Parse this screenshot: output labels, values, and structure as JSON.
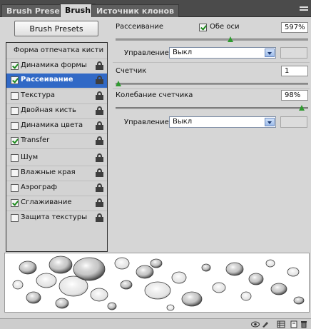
{
  "tabs": [
    {
      "label": "Brush Presets"
    },
    {
      "label": "Brush"
    },
    {
      "label": "Источник клонов"
    }
  ],
  "preset_button": "Brush Presets",
  "list": {
    "header": "Форма отпечатка кисти",
    "items": [
      {
        "label": "Динамика формы",
        "checked": true,
        "selected": false
      },
      {
        "label": "Рассеивание",
        "checked": true,
        "selected": true
      },
      {
        "label": "Текстура",
        "checked": false,
        "selected": false
      },
      {
        "label": "Двойная кисть",
        "checked": false,
        "selected": false
      },
      {
        "label": "Динамика цвета",
        "checked": false,
        "selected": false
      },
      {
        "label": "Transfer",
        "checked": true,
        "selected": false
      },
      {
        "label": "Шум",
        "checked": false,
        "selected": false
      },
      {
        "label": "Влажные края",
        "checked": false,
        "selected": false
      },
      {
        "label": "Аэрограф",
        "checked": false,
        "selected": false
      },
      {
        "label": "Сглаживание",
        "checked": true,
        "selected": false
      },
      {
        "label": "Защита текстуры",
        "checked": false,
        "selected": false
      }
    ]
  },
  "scatter": {
    "label": "Рассеивание",
    "both_axes_label": "Обе оси",
    "both_axes_checked": true,
    "value": "597%",
    "slider_fraction": 0.6,
    "control_label": "Управление:",
    "control_value": "Выкл"
  },
  "count": {
    "label": "Счетчик",
    "value": "1",
    "slider_fraction": 0.0
  },
  "count_jitter": {
    "label": "Колебание счетчика",
    "value": "98%",
    "slider_fraction": 0.98,
    "control_label": "Управление:",
    "control_value": "Выкл"
  },
  "colors": {
    "selection": "#3169c6",
    "slider_thumb": "#2f9a2f",
    "check": "#1c8a1c"
  }
}
